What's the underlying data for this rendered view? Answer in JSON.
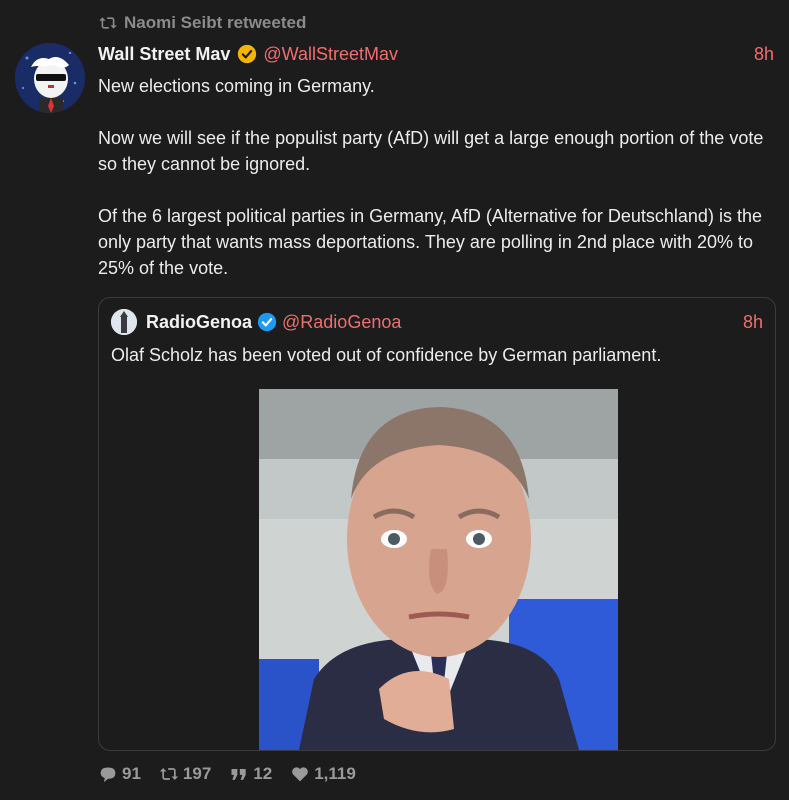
{
  "retweet": {
    "label": "Naomi Seibt retweeted"
  },
  "tweet": {
    "author_name": "Wall Street Mav",
    "handle": "@WallStreetMav",
    "time": "8h",
    "paragraphs": [
      "New elections coming in Germany.",
      "Now we will see if the populist party (AfD) will get a large enough portion of the vote so they cannot be ignored.",
      "Of the 6 largest political parties in Germany, AfD (Alternative for Deutschland) is the only party that wants mass deportations. They are polling in 2nd place with 20% to 25% of the vote."
    ]
  },
  "quote": {
    "author_name": "RadioGenoa",
    "handle": "@RadioGenoa",
    "time": "8h",
    "text": "Olaf Scholz has been voted out of confidence by German parliament."
  },
  "actions": {
    "replies": "91",
    "retweets": "197",
    "quotes": "12",
    "likes": "1,119"
  },
  "colors": {
    "background": "#1c1c1d",
    "accent": "#f06e6e",
    "muted": "#8b8b8b",
    "verified_gold": "#f4b400",
    "verified_blue": "#1d9bf0"
  }
}
